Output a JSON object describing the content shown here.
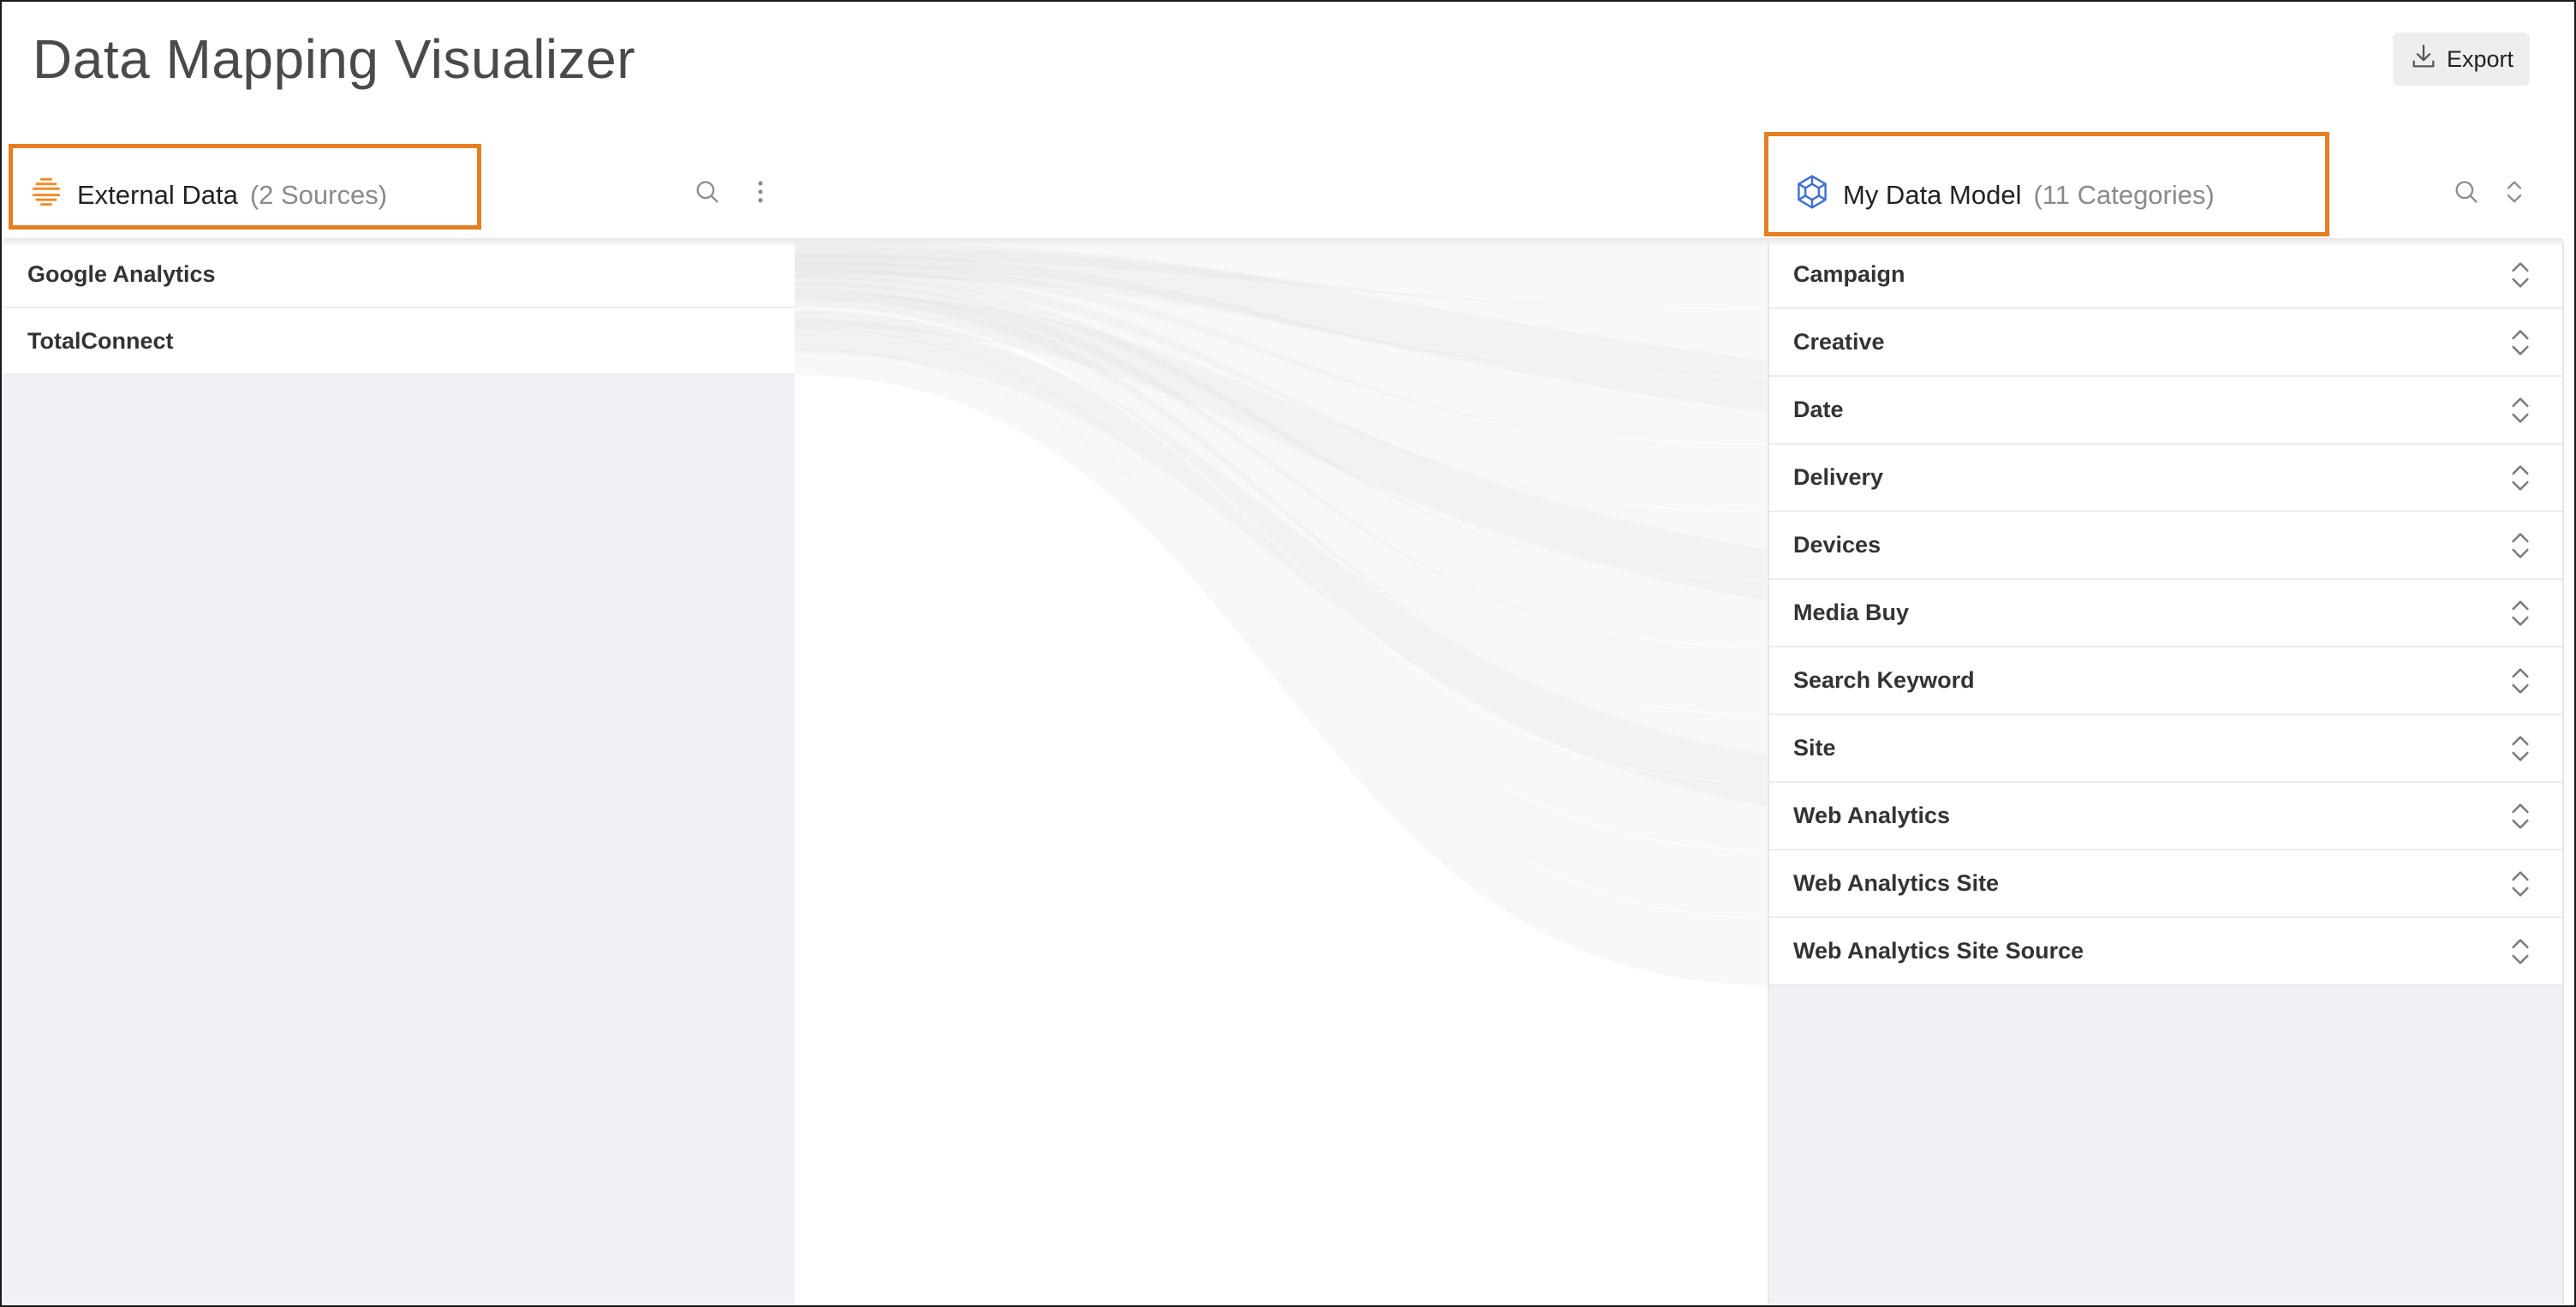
{
  "header": {
    "title": "Data Mapping Visualizer",
    "export_label": "Export"
  },
  "external": {
    "title": "External Data",
    "count": "(2 Sources)",
    "sources": [
      {
        "label": "Google Analytics"
      },
      {
        "label": "TotalConnect"
      }
    ]
  },
  "model": {
    "title": "My Data Model",
    "count": "(11 Categories)",
    "categories": [
      {
        "label": "Campaign"
      },
      {
        "label": "Creative"
      },
      {
        "label": "Date"
      },
      {
        "label": "Delivery"
      },
      {
        "label": "Devices"
      },
      {
        "label": "Media Buy"
      },
      {
        "label": "Search Keyword"
      },
      {
        "label": "Site"
      },
      {
        "label": "Web Analytics"
      },
      {
        "label": "Web Analytics Site"
      },
      {
        "label": "Web Analytics Site Source"
      }
    ]
  },
  "colors": {
    "accent_highlight": "#e67e22",
    "external_icon": "#f08a24",
    "model_icon": "#3d6fd1",
    "flow": "#d9d9dc"
  },
  "icons": {
    "external": "layers-icon",
    "model": "cube-network-icon",
    "search": "search-icon",
    "more": "kebab-menu-icon",
    "sort": "sort-arrows-icon",
    "export": "download-icon"
  }
}
